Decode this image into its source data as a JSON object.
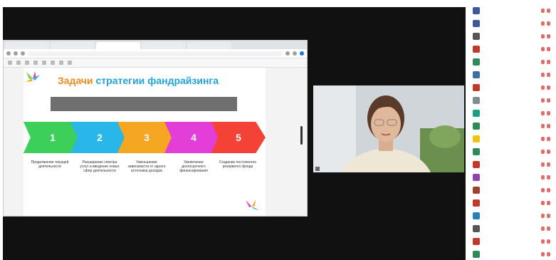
{
  "slide": {
    "title_part1": "Задачи",
    "title_part2": "стратегии фандрайзинга",
    "steps": [
      {
        "num": "1",
        "color": "#3ccf5a",
        "label": "Продолжение текущей деятельности"
      },
      {
        "num": "2",
        "color": "#29b6e8",
        "label": "Расширение спектра услуг и введение новых сфер деятельности"
      },
      {
        "num": "3",
        "color": "#f5a623",
        "label": "Уменьшение зависимости от одного источника доходов"
      },
      {
        "num": "4",
        "color": "#e43ed8",
        "label": "Увеличение долгосрочного финансирования"
      },
      {
        "num": "5",
        "color": "#f44336",
        "label": "Создание постоянного резервного фонда"
      }
    ]
  },
  "colors": {
    "burst_green": "#7bd14b",
    "burst_pink": "#e84fb5",
    "burst_blue": "#33aee6",
    "burst_orange": "#f7a21b"
  },
  "participants": [
    {
      "color": "#3b5998"
    },
    {
      "color": "#3b5998"
    },
    {
      "color": "#555555"
    },
    {
      "color": "#c0392b"
    },
    {
      "color": "#2e8b57"
    },
    {
      "color": "#3a6ea5"
    },
    {
      "color": "#c0392b"
    },
    {
      "color": "#7f8c8d"
    },
    {
      "color": "#16a085"
    },
    {
      "color": "#2e8b57"
    },
    {
      "color": "#f1c40f"
    },
    {
      "color": "#2e8b57"
    },
    {
      "color": "#c0392b"
    },
    {
      "color": "#8e44ad"
    },
    {
      "color": "#a04030"
    },
    {
      "color": "#c0392b"
    },
    {
      "color": "#2980b9"
    },
    {
      "color": "#555555"
    },
    {
      "color": "#c0392b"
    },
    {
      "color": "#2e8b57"
    }
  ]
}
